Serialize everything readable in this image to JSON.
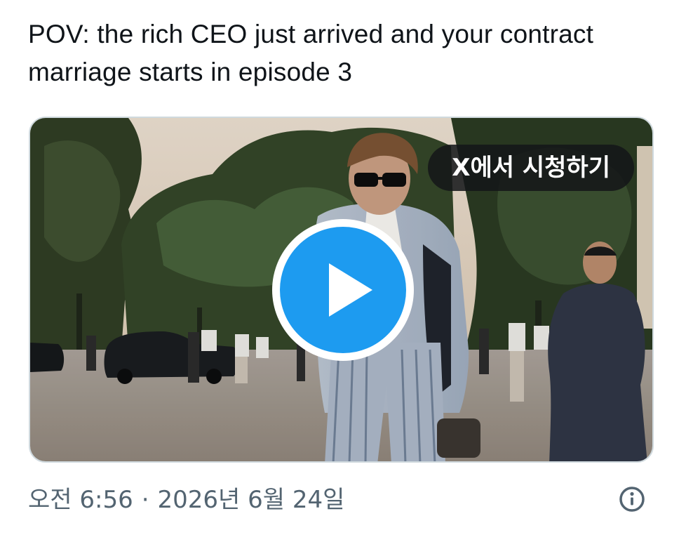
{
  "tweet": {
    "text": "POV: the rich CEO just arrived and your contract marriage starts in episode 3"
  },
  "media": {
    "watch_on_x_label": "X에서 시청하기",
    "play_icon": "play-icon"
  },
  "meta": {
    "time": "오전 6:56",
    "separator": "·",
    "date": "2026년 6월 24일",
    "info_icon": "info-icon"
  },
  "colors": {
    "accent": "#1d9bf0",
    "text_primary": "#0f1419",
    "text_secondary": "#536471",
    "card_border": "#cfd9de"
  }
}
